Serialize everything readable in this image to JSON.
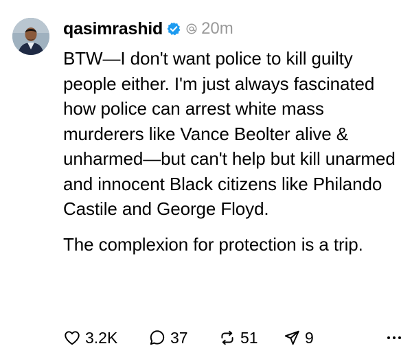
{
  "post": {
    "username": "qasimrashid",
    "time": "20m",
    "paragraphs": [
      "BTW—I don't want police to kill guilty people either. I'm just always fascinated how police can arrest white mass murderers like Vance Beolter alive & unharmed—but can't help but kill unarmed and innocent Black citizens like Philando Castile and George Floyd.",
      "The complexion for protection is a trip."
    ],
    "verified_icon": "verified-badge-icon",
    "accent": "#1d9bf0"
  },
  "actions": {
    "likes": "3.2K",
    "replies": "37",
    "reposts": "51",
    "shares": "9"
  }
}
